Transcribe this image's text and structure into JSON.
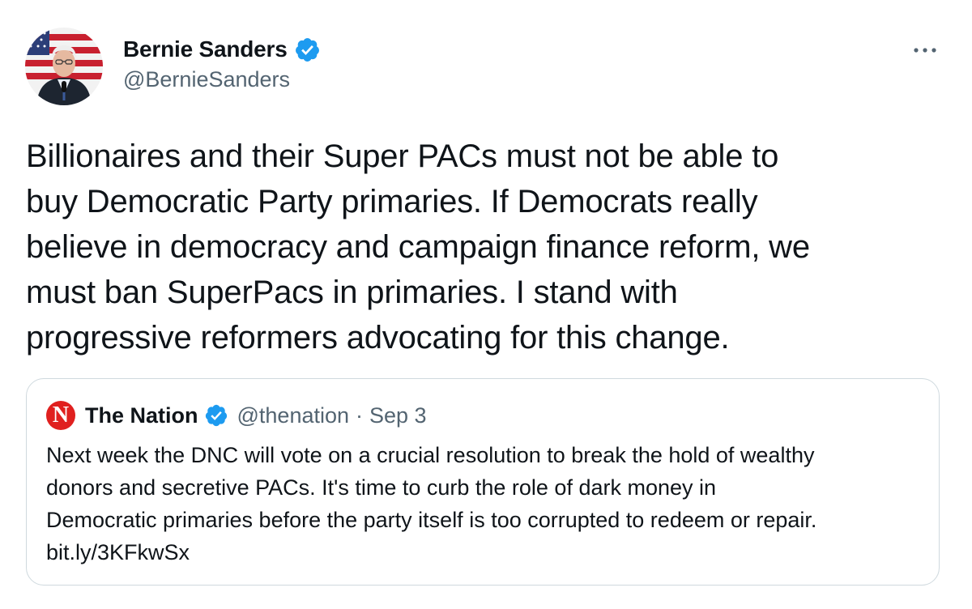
{
  "author": {
    "name": "Bernie Sanders",
    "handle": "@BernieSanders",
    "verified": true
  },
  "tweet": {
    "text": "Billionaires and their Super PACs must not be able to\nbuy Democratic Party primaries. If Democrats really\nbelieve in democracy and campaign finance reform, we\nmust ban SuperPacs in primaries. I stand with\nprogressive reformers advocating for this change."
  },
  "more_icon": "more-horizontal-icon",
  "quoted_tweet": {
    "logo_letter": "N",
    "name": "The Nation",
    "verified": true,
    "handle": "@thenation",
    "separator": "·",
    "date": "Sep 3",
    "text": "Next week the DNC will vote on a crucial resolution to break the hold of wealthy\ndonors and secretive PACs. It's time to curb the role of dark money in\nDemocratic primaries before the party itself is too corrupted to redeem or repair.\n",
    "link": "bit.ly/3KFkwSx"
  },
  "colors": {
    "verified_blue": "#1d9bf0",
    "secondary_text": "#536471",
    "nation_red": "#e0201f",
    "border": "#cfd9de"
  }
}
